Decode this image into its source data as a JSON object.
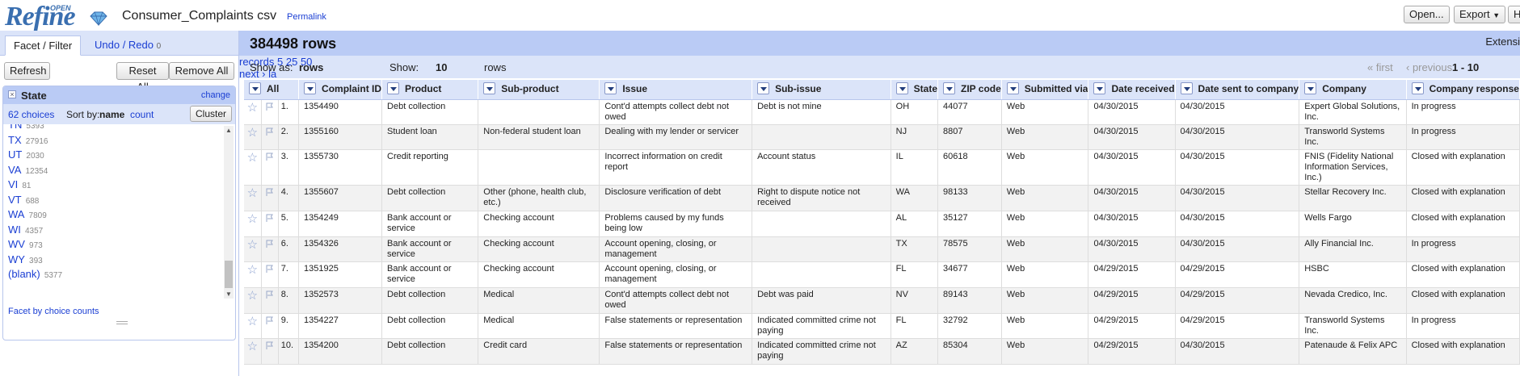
{
  "header": {
    "logo_text": "Refine",
    "logo_superscript": "OPEN",
    "project_title": "Consumer_Complaints csv",
    "permalink": "Permalink",
    "open_button": "Open...",
    "export_button": "Export",
    "help_button": "H"
  },
  "left_panel": {
    "tab_facet": "Facet / Filter",
    "tab_undo": "Undo / Redo",
    "undo_count": "0",
    "refresh_button": "Refresh",
    "reset_all_button": "Reset All",
    "remove_all_button": "Remove All",
    "facet": {
      "title": "State",
      "change_link": "change",
      "choices_text": "62 choices",
      "sort_by_label": "Sort by:",
      "sort_name": "name",
      "sort_count": "count",
      "cluster_button": "Cluster",
      "items": [
        {
          "name": "TN",
          "count": "5393"
        },
        {
          "name": "TX",
          "count": "27916"
        },
        {
          "name": "UT",
          "count": "2030"
        },
        {
          "name": "VA",
          "count": "12354"
        },
        {
          "name": "VI",
          "count": "81"
        },
        {
          "name": "VT",
          "count": "688"
        },
        {
          "name": "WA",
          "count": "7809"
        },
        {
          "name": "WI",
          "count": "4357"
        },
        {
          "name": "WV",
          "count": "973"
        },
        {
          "name": "WY",
          "count": "393"
        },
        {
          "name": "(blank)",
          "count": "5377"
        }
      ],
      "footer_link": "Facet by choice counts"
    }
  },
  "summary": {
    "row_count": "384498 rows",
    "extensions": "Extensi"
  },
  "view_bar": {
    "show_as_label": "Show as:",
    "rows_mode": "rows",
    "records_mode": "records",
    "show_label": "Show:",
    "page_sizes": [
      "5",
      "10",
      "25",
      "50"
    ],
    "current_page_size": "10",
    "rows_suffix": "rows",
    "first": "« first",
    "previous": "‹ previous",
    "range": "1 - 10",
    "next": "next ›",
    "last": "la"
  },
  "table": {
    "all_label": "All",
    "columns": [
      "Complaint ID",
      "Product",
      "Sub-product",
      "Issue",
      "Sub-issue",
      "State",
      "ZIP code",
      "Submitted via",
      "Date received",
      "Date sent to company",
      "Company",
      "Company response"
    ],
    "rows": [
      {
        "idx": "1.",
        "cells": [
          "1354490",
          "Debt collection",
          "",
          "Cont'd attempts collect debt not owed",
          "Debt is not mine",
          "OH",
          "44077",
          "Web",
          "04/30/2015",
          "04/30/2015",
          "Expert Global Solutions, Inc.",
          "In progress"
        ]
      },
      {
        "idx": "2.",
        "cells": [
          "1355160",
          "Student loan",
          "Non-federal student loan",
          "Dealing with my lender or servicer",
          "",
          "NJ",
          "8807",
          "Web",
          "04/30/2015",
          "04/30/2015",
          "Transworld Systems Inc.",
          "In progress"
        ]
      },
      {
        "idx": "3.",
        "cells": [
          "1355730",
          "Credit reporting",
          "",
          "Incorrect information on credit report",
          "Account status",
          "IL",
          "60618",
          "Web",
          "04/30/2015",
          "04/30/2015",
          "FNIS (Fidelity National Information Services, Inc.)",
          "Closed with explanation"
        ]
      },
      {
        "idx": "4.",
        "cells": [
          "1355607",
          "Debt collection",
          "Other (phone, health club, etc.)",
          "Disclosure verification of debt",
          "Right to dispute notice not received",
          "WA",
          "98133",
          "Web",
          "04/30/2015",
          "04/30/2015",
          "Stellar Recovery Inc.",
          "Closed with explanation"
        ]
      },
      {
        "idx": "5.",
        "cells": [
          "1354249",
          "Bank account or service",
          "Checking account",
          "Problems caused by my funds being low",
          "",
          "AL",
          "35127",
          "Web",
          "04/30/2015",
          "04/30/2015",
          "Wells Fargo",
          "Closed with explanation"
        ]
      },
      {
        "idx": "6.",
        "cells": [
          "1354326",
          "Bank account or service",
          "Checking account",
          "Account opening, closing, or management",
          "",
          "TX",
          "78575",
          "Web",
          "04/30/2015",
          "04/30/2015",
          "Ally Financial Inc.",
          "In progress"
        ]
      },
      {
        "idx": "7.",
        "cells": [
          "1351925",
          "Bank account or service",
          "Checking account",
          "Account opening, closing, or management",
          "",
          "FL",
          "34677",
          "Web",
          "04/29/2015",
          "04/29/2015",
          "HSBC",
          "Closed with explanation"
        ]
      },
      {
        "idx": "8.",
        "cells": [
          "1352573",
          "Debt collection",
          "Medical",
          "Cont'd attempts collect debt not owed",
          "Debt was paid",
          "NV",
          "89143",
          "Web",
          "04/29/2015",
          "04/29/2015",
          "Nevada Credico, Inc.",
          "Closed with explanation"
        ]
      },
      {
        "idx": "9.",
        "cells": [
          "1354227",
          "Debt collection",
          "Medical",
          "False statements or representation",
          "Indicated committed crime not paying",
          "FL",
          "32792",
          "Web",
          "04/29/2015",
          "04/29/2015",
          "Transworld Systems Inc.",
          "In progress"
        ]
      },
      {
        "idx": "10.",
        "cells": [
          "1354200",
          "Debt collection",
          "Credit card",
          "False statements or representation",
          "Indicated committed crime not paying",
          "AZ",
          "85304",
          "Web",
          "04/29/2015",
          "04/30/2015",
          "Patenaude & Felix APC",
          "Closed with explanation"
        ]
      }
    ]
  },
  "colors": {
    "accent_dark": "#bacbf5",
    "accent_light": "#dbe4f9",
    "link": "#1a3ed3"
  }
}
